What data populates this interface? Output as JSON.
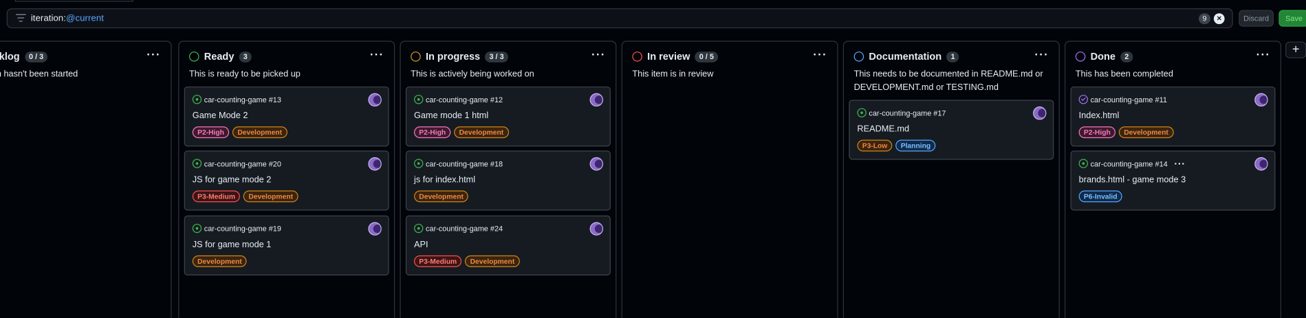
{
  "filter": {
    "key": "iteration:",
    "value": "@current",
    "count": "9",
    "clear_icon": "close-circle-icon"
  },
  "actions": {
    "discard_label": "Discard",
    "save_label": "Save",
    "add_column_label": "+"
  },
  "colors": {
    "green": "#3fb950",
    "orange": "#d29922",
    "red": "#f85149",
    "blue": "#58a6ff",
    "purple": "#a371f7",
    "pink": "#f778ba"
  },
  "columns": [
    {
      "title": "Backlog",
      "count": "0 / 3",
      "description": "This item hasn't been started",
      "menu": "···",
      "cards": []
    },
    {
      "title": "Ready",
      "count": "3",
      "description": "This is ready to be picked up",
      "menu": "···",
      "cards": [
        {
          "ref": "car-counting-game #13",
          "title": "Game Mode 2",
          "labels": [
            "P2-High",
            "Development"
          ]
        },
        {
          "ref": "car-counting-game #20",
          "title": "JS for game mode 2",
          "labels": [
            "P3-Medium",
            "Development"
          ]
        },
        {
          "ref": "car-counting-game #19",
          "title": "JS for game mode 1",
          "labels": [
            "Development"
          ]
        }
      ]
    },
    {
      "title": "In progress",
      "count": "3 / 3",
      "description": "This is actively being worked on",
      "menu": "···",
      "cards": [
        {
          "ref": "car-counting-game #12",
          "title": "Game mode 1 html",
          "labels": [
            "P2-High",
            "Development"
          ]
        },
        {
          "ref": "car-counting-game #18",
          "title": "js for index.html",
          "labels": [
            "Development"
          ]
        },
        {
          "ref": "car-counting-game #24",
          "title": "API",
          "labels": [
            "P3-Medium",
            "Development"
          ]
        }
      ]
    },
    {
      "title": "In review",
      "count": "0 / 5",
      "description": "This item is in review",
      "menu": "···",
      "cards": []
    },
    {
      "title": "Documentation",
      "count": "1",
      "description_line1": "This needs to be documented in README.md or",
      "description_line2": "DEVELOPMENT.md or TESTING.md",
      "menu": "···",
      "cards": [
        {
          "ref": "car-counting-game #17",
          "title": "README.md",
          "labels": [
            "P3-Low",
            "Planning"
          ]
        }
      ]
    },
    {
      "title": "Done",
      "count": "2",
      "description": "This has been completed",
      "menu": "···",
      "cards": [
        {
          "ref": "car-counting-game #11",
          "title": "Index.html",
          "labels": [
            "P2-High",
            "Development"
          ]
        },
        {
          "ref": "car-counting-game #14",
          "more": "···",
          "title": "brands.html - game mode 3",
          "labels": [
            "P6-Invalid"
          ]
        }
      ]
    }
  ]
}
